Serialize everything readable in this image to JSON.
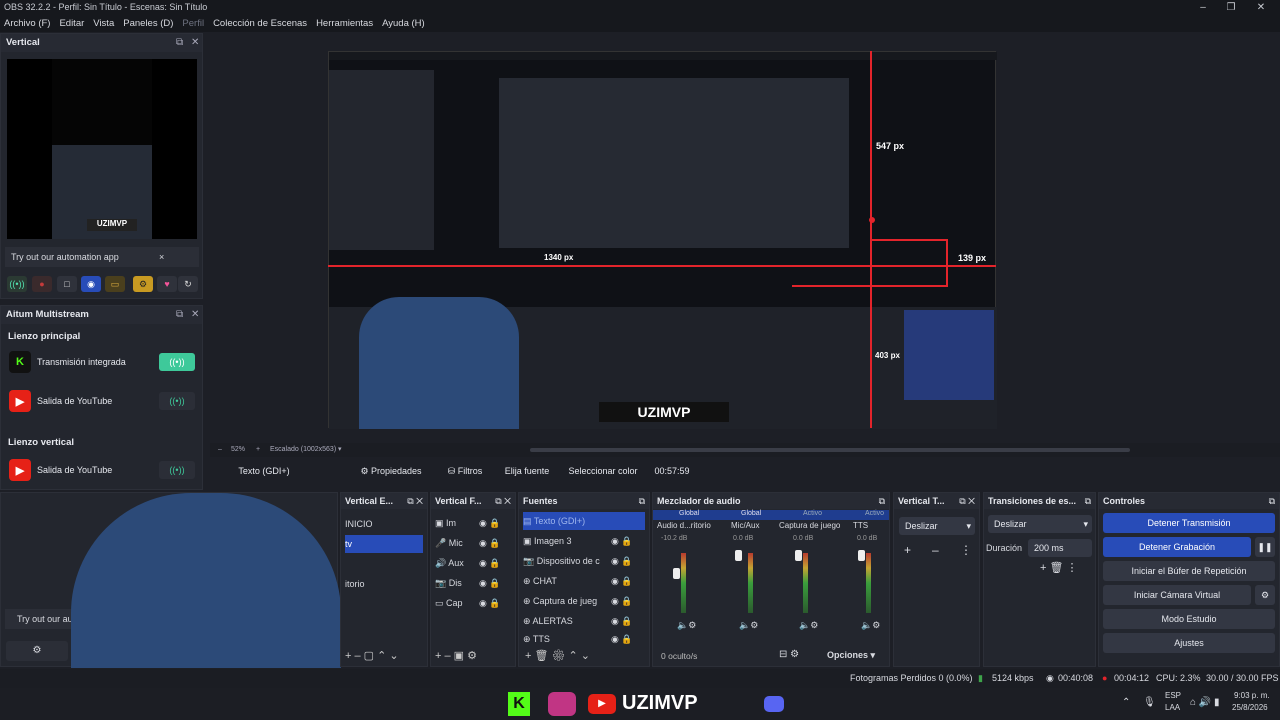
{
  "window": {
    "title": "OBS 32.2.2 - Perfil: Sin Título - Escenas: Sin Título"
  },
  "menu": [
    "Archivo (F)",
    "Editar",
    "Vista",
    "Paneles (D)",
    "Perfil",
    "Colección de Escenas",
    "Herramientas",
    "Ayuda (H)"
  ],
  "vertical": {
    "title": "Vertical",
    "automation_label": "Try out our automation app",
    "close_glyph": "×"
  },
  "multistream": {
    "title": "Aitum Multistream",
    "main_canvas": "Lienzo principal",
    "vertical_canvas": "Lienzo vertical",
    "outputs_main": [
      {
        "label": "Transmisión integrada",
        "icon": "kick-icon",
        "active": true
      },
      {
        "label": "Salida de YouTube",
        "icon": "youtube-icon",
        "active": false
      }
    ],
    "outputs_vertical": [
      {
        "label": "Salida de YouTube",
        "icon": "youtube-icon",
        "active": false
      }
    ]
  },
  "canvas": {
    "zoom": "52%",
    "scale": "Escalado (1002x563)",
    "measure_width": "1340 px",
    "measure_top": "547 px",
    "measure_right": "139 px",
    "measure_bottom": "403 px",
    "overlay_text": "UZIMVP"
  },
  "source_toolbar": {
    "source": "Texto (GDI+)",
    "properties": "Propiedades",
    "filters": "Filtros",
    "font": "Elija fuente",
    "color": "Seleccionar color",
    "time": "00:57:59"
  },
  "left_bottom": {
    "automation_label": "Try out our automatio"
  },
  "panels": {
    "vertical_e": {
      "title": "Vertical E...",
      "items": [
        "INICIO",
        "tv",
        "itorio"
      ]
    },
    "vertical_f": {
      "title": "Vertical F...",
      "items": [
        "Im",
        "Mic",
        "Aux",
        "Dis",
        "Cap"
      ]
    },
    "sources": {
      "title": "Fuentes",
      "items": [
        "Texto (GDI+)",
        "Imagen 3",
        "Dispositivo de c",
        "CHAT",
        "Captura de jueg",
        "ALERTAS",
        "TTS"
      ]
    },
    "mixer": {
      "title": "Mezclador de audio",
      "tabs": [
        "Global",
        "Global",
        "Activo",
        "Activo"
      ],
      "channels": [
        {
          "name": "Audio d...ritorio",
          "db": "-10.2 dB"
        },
        {
          "name": "Mic/Aux",
          "db": "0.0 dB"
        },
        {
          "name": "Captura de juego",
          "db": "0.0 dB"
        },
        {
          "name": "TTS",
          "db": "0.0 dB"
        }
      ],
      "hidden": "0 oculto/s",
      "options": "Opciones"
    },
    "vertical_t": {
      "title": "Vertical T...",
      "value": "Deslizar"
    },
    "transitions": {
      "title": "Transiciones de es...",
      "value": "Deslizar",
      "duration_label": "Duración",
      "duration_value": "200 ms"
    },
    "controls": {
      "title": "Controles",
      "buttons": [
        "Detener Transmisión",
        "Detener Grabación",
        "Iniciar el Búfer de Repetición",
        "Iniciar Cámara Virtual",
        "Modo Estudio",
        "Ajustes"
      ]
    }
  },
  "status": {
    "frames": "Fotogramas Perdidos 0 (0.0%)",
    "kbps": "5124 kbps",
    "stream_time": "00:40:08",
    "rec_time": "00:04:12",
    "cpu": "CPU: 2.3%",
    "fps": "30.00 / 30.00 FPS"
  },
  "taskbar": {
    "lang1": "ESP",
    "lang2": "LAA",
    "time": "9:03 p. m.",
    "date": "25/8/2026",
    "overlay": "UZIMVP"
  }
}
